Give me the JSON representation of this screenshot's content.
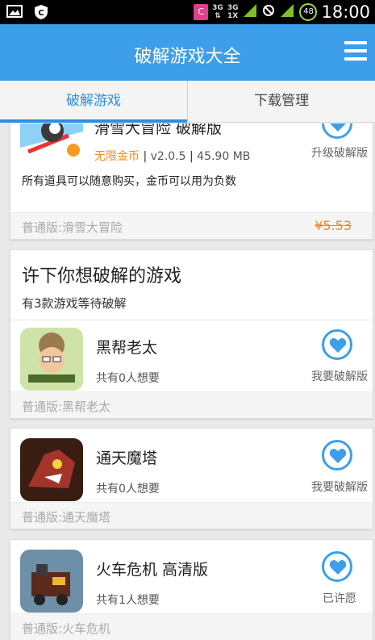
{
  "status_bar": {
    "carrier_badge": "C",
    "net1": "3G",
    "net2": "3G",
    "net2_sub": "1X",
    "battery": "48",
    "time": "18:00"
  },
  "header": {
    "title": "破解游戏大全"
  },
  "tabs": [
    {
      "label": "破解游戏",
      "active": true
    },
    {
      "label": "下载管理",
      "active": false
    }
  ],
  "top_card": {
    "name": "滑雪大冒险 破解版",
    "tag": "无限金币",
    "version": "v2.0.5",
    "size": "45.90 MB",
    "description": "所有道具可以随意购买，金币可以用为负数",
    "action_label": "升级破解版",
    "footer": "普通版:滑雪大冒险",
    "price": "¥5.53"
  },
  "wish_section": {
    "title": "许下你想破解的游戏",
    "subtitle": "有3款游戏等待破解"
  },
  "wish_items": [
    {
      "name": "黑帮老太",
      "count": "共有0人想要",
      "action_label": "我要破解版",
      "footer": "普通版:黑帮老太"
    },
    {
      "name": "通天魔塔",
      "count": "共有0人想要",
      "action_label": "我要破解版",
      "footer": "普通版:通天魔塔"
    },
    {
      "name": "火车危机 高清版",
      "count": "共有1人想要",
      "action_label": "已许愿",
      "footer": "普通版:火车危机"
    }
  ],
  "colors": {
    "accent": "#3d9ee9",
    "tag": "#f08a24",
    "price": "#f08a24"
  }
}
